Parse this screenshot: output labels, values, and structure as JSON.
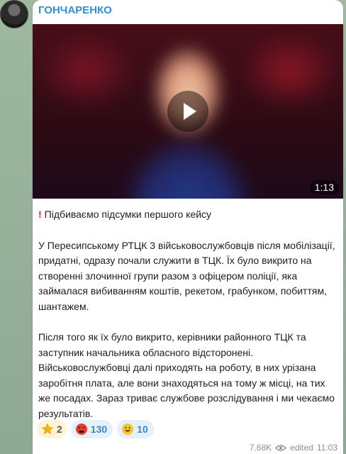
{
  "post": {
    "sender": "ГОНЧАРЕНКО",
    "video_duration": "1:13",
    "headline": "Підбиваємо підсумки першого кейсу",
    "paragraph1": "У Пересипському РТЦК 3 військовослужбовців після мобілізації, придатні, одразу почали служити в ТЦК. Їх було викрито на створенні злочинної групи разом з офіцером поліції, яка займалася вибиванням коштів, рекетом, грабунком, побиттям, шантажем.",
    "paragraph2": "Після того як їх було викрито, керівники районного ТЦК та заступник начальника обласного відсторонені. Військовослужбовці далі приходять на роботу, в них урізана заробітня плата, але вони знаходяться на тому ж місці, на тих же посадах. Зараз триває службове розслідування і ми чекаємо результатів.",
    "reactions": [
      {
        "icon": "star-icon",
        "count": "2"
      },
      {
        "icon": "angry-face-icon",
        "count": "130"
      },
      {
        "icon": "grinning-face-icon",
        "count": "10"
      }
    ],
    "views": "7.68K",
    "edited_label": "edited",
    "time": "11:03"
  },
  "colors": {
    "sender": "#2f8fd6",
    "accent": "#3a86c8",
    "exclamation": "#e0263a"
  }
}
